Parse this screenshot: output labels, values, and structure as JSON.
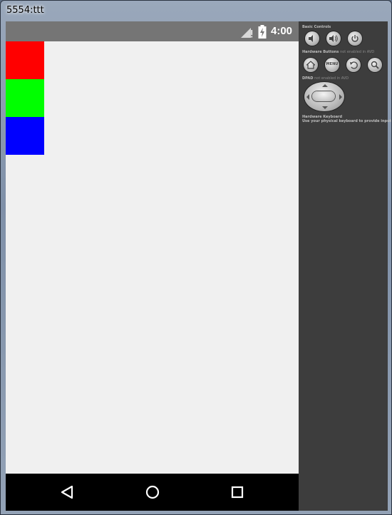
{
  "window": {
    "title": "5554:ttt"
  },
  "statusbar": {
    "time": "4:00",
    "signal_icon": "signal-icon",
    "battery_icon": "battery-icon"
  },
  "app": {
    "boxes": [
      {
        "name": "red",
        "color": "#ff0000"
      },
      {
        "name": "green",
        "color": "#00ff00"
      },
      {
        "name": "blue",
        "color": "#0000ff"
      }
    ]
  },
  "navbar": {
    "back_icon": "back-icon",
    "home_icon": "home-icon",
    "recents_icon": "recents-icon"
  },
  "panel": {
    "basic_controls": "Basic Controls",
    "hardware_buttons": "Hardware Buttons",
    "hardware_buttons_note": "not enabled in AVD",
    "dpad": "DPAD",
    "dpad_note": "not enabled in AVD",
    "hardware_keyboard": "Hardware Keyboard",
    "hardware_keyboard_note": "Use your physical keyboard to provide input",
    "menu_label": "MENU"
  },
  "colors": {
    "statusbar": "#757575",
    "screen_bg": "#f0f0f0",
    "panel_bg": "#3d3d3d",
    "navbar": "#000000"
  }
}
